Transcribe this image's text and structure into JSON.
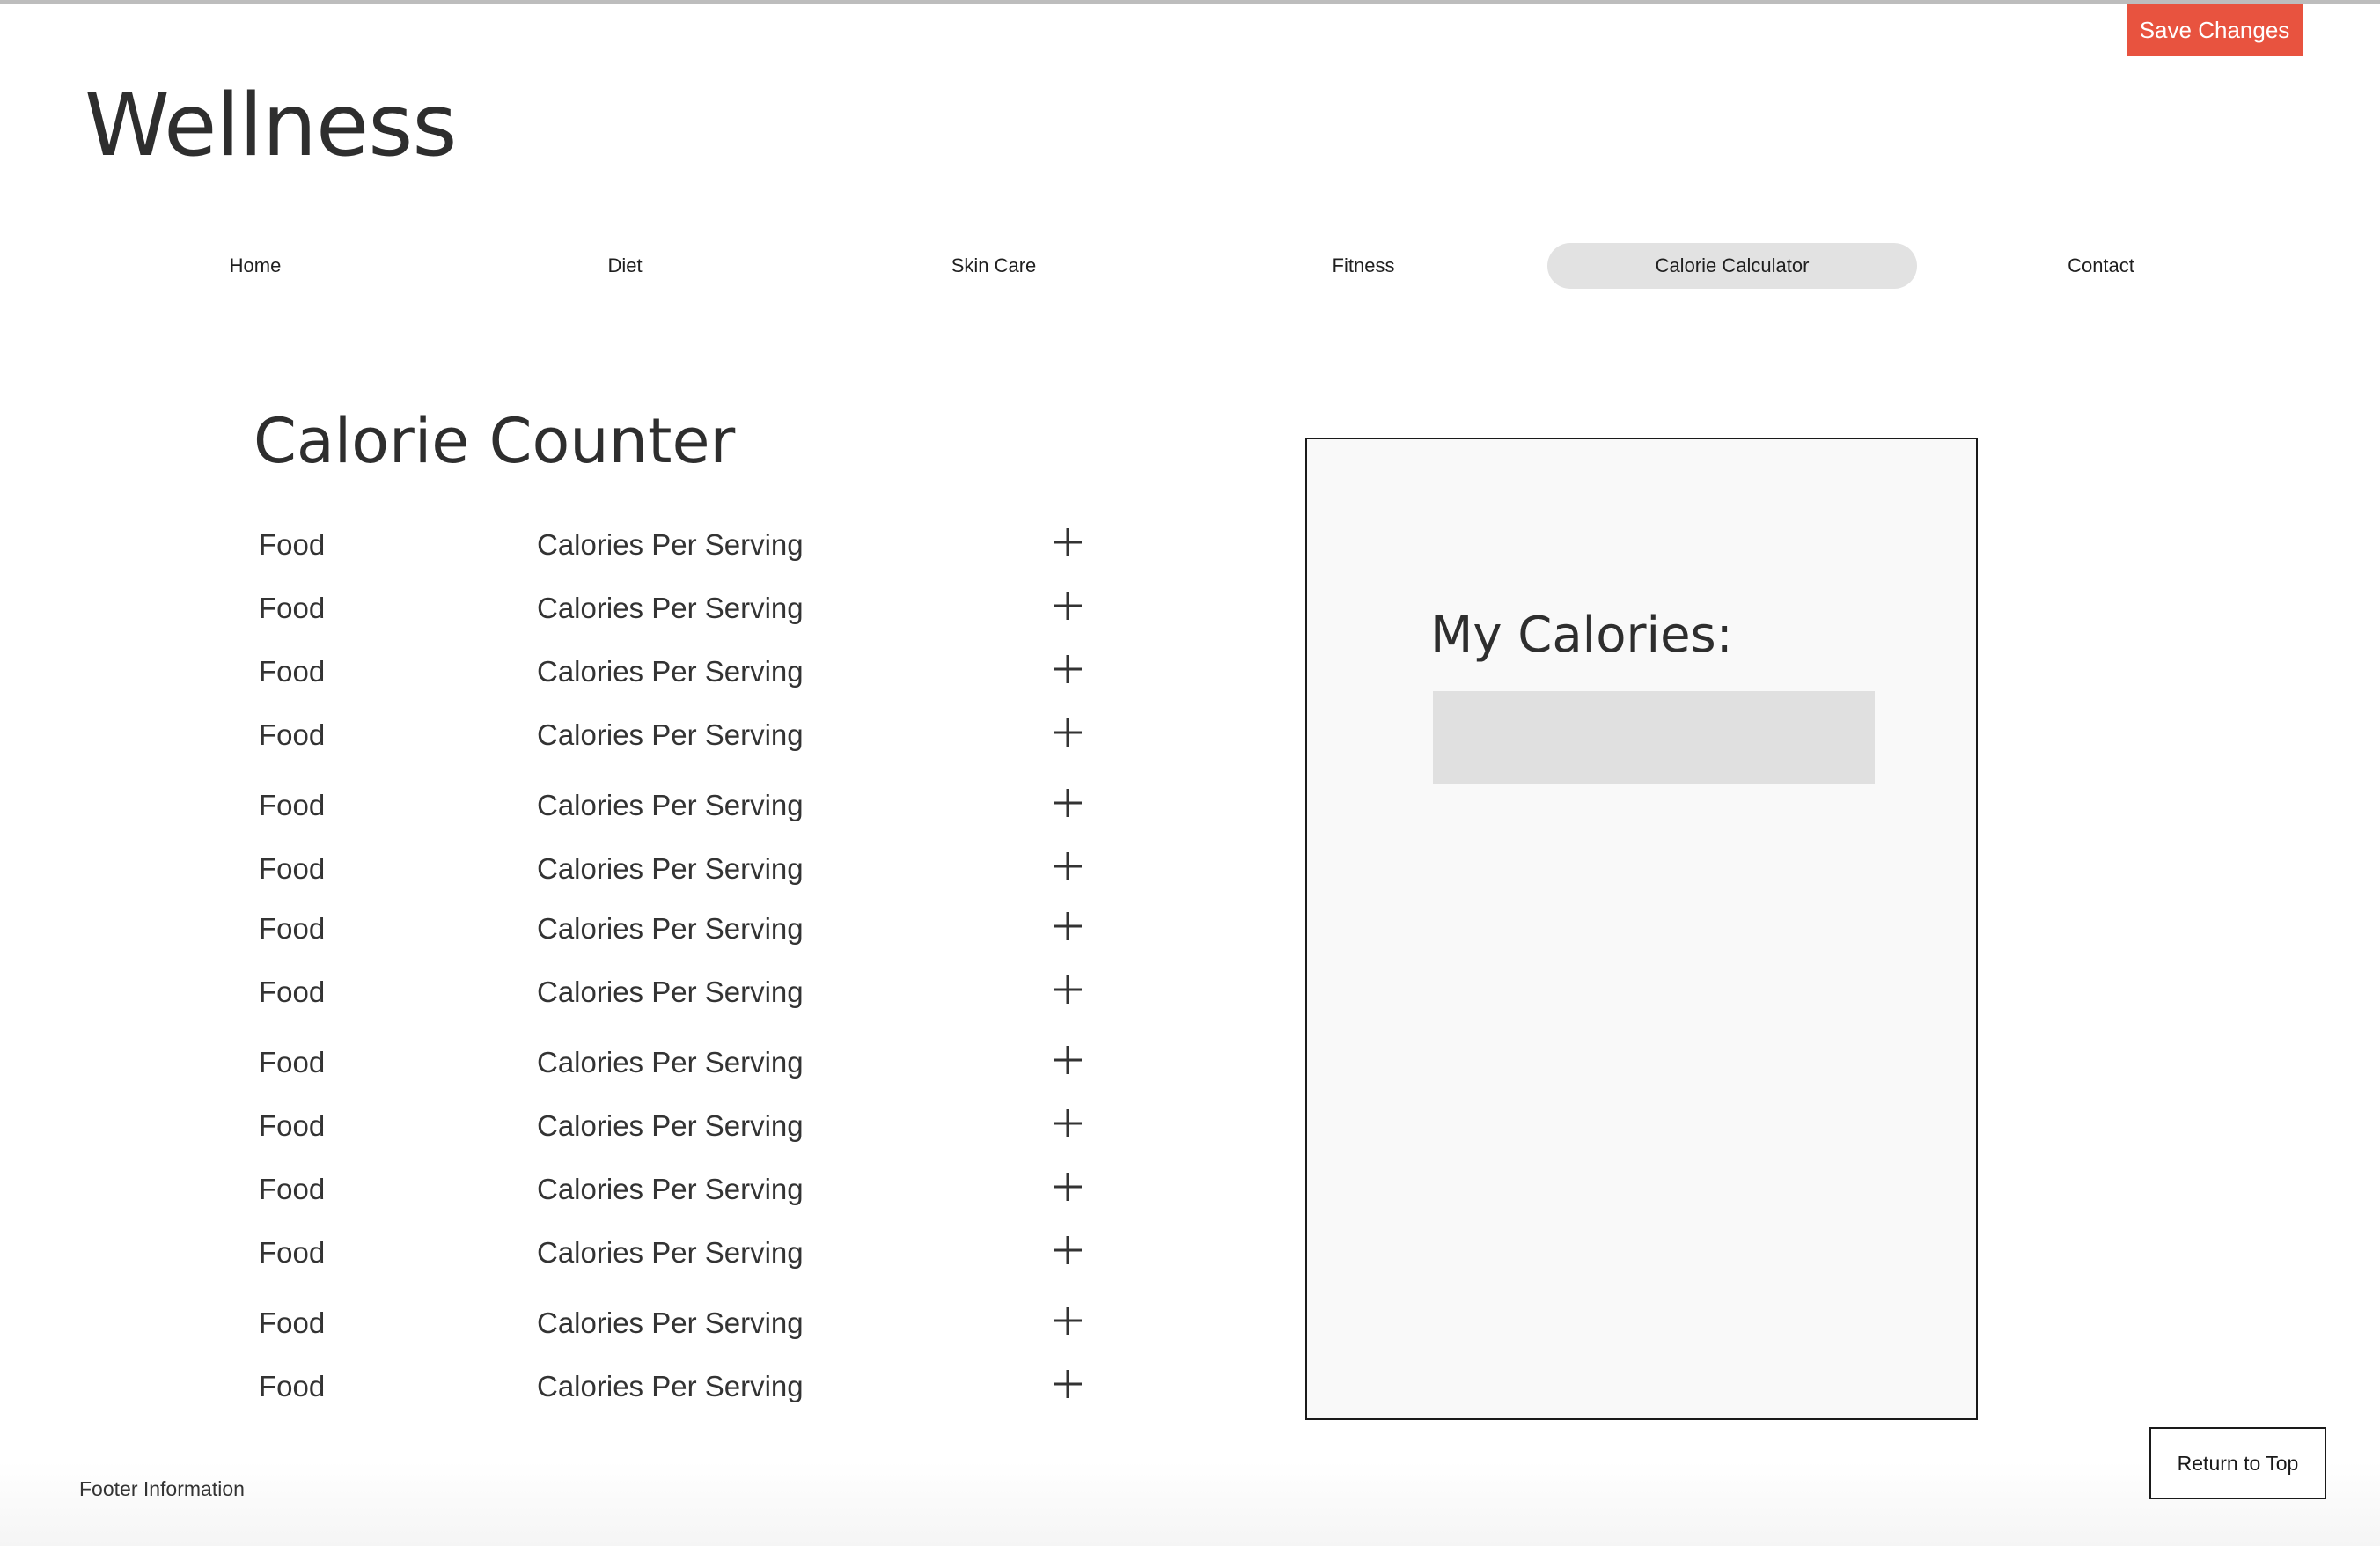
{
  "header": {
    "save_label": "Save Changes",
    "site_title": "Wellness"
  },
  "nav": {
    "items": [
      {
        "label": "Home"
      },
      {
        "label": "Diet"
      },
      {
        "label": "Skin Care"
      },
      {
        "label": "Fitness"
      },
      {
        "label": "Calorie Calculator",
        "active": true
      },
      {
        "label": "Contact"
      }
    ]
  },
  "counter": {
    "title": "Calorie Counter",
    "rows": [
      {
        "food": "Food",
        "calories": "Calories Per Serving",
        "action_icon": "plus-icon"
      },
      {
        "food": "Food",
        "calories": "Calories Per Serving",
        "action_icon": "plus-icon"
      },
      {
        "food": "Food",
        "calories": "Calories Per Serving",
        "action_icon": "plus-icon"
      },
      {
        "food": "Food",
        "calories": "Calories Per Serving",
        "action_icon": "plus-icon"
      },
      {
        "food": "Food",
        "calories": "Calories Per Serving",
        "action_icon": "plus-icon"
      },
      {
        "food": "Food",
        "calories": "Calories Per Serving",
        "action_icon": "plus-icon"
      },
      {
        "food": "Food",
        "calories": "Calories Per Serving",
        "action_icon": "plus-icon"
      },
      {
        "food": "Food",
        "calories": "Calories Per Serving",
        "action_icon": "plus-icon"
      },
      {
        "food": "Food",
        "calories": "Calories Per Serving",
        "action_icon": "plus-icon"
      },
      {
        "food": "Food",
        "calories": "Calories Per Serving",
        "action_icon": "plus-icon"
      },
      {
        "food": "Food",
        "calories": "Calories Per Serving",
        "action_icon": "plus-icon"
      },
      {
        "food": "Food",
        "calories": "Calories Per Serving",
        "action_icon": "plus-icon"
      },
      {
        "food": "Food",
        "calories": "Calories Per Serving",
        "action_icon": "plus-icon"
      },
      {
        "food": "Food",
        "calories": "Calories Per Serving",
        "action_icon": "plus-icon"
      }
    ]
  },
  "calories_panel": {
    "heading": "My Calories:",
    "value": "",
    "placeholder": ""
  },
  "footer": {
    "info": "Footer Information",
    "return_label": "Return to Top"
  },
  "colors": {
    "accent": "#e8533f",
    "nav_active": "#e2e2e2",
    "panel_bg": "#f9f9f9",
    "input_bg": "#e0e0e0",
    "text": "#333333"
  }
}
